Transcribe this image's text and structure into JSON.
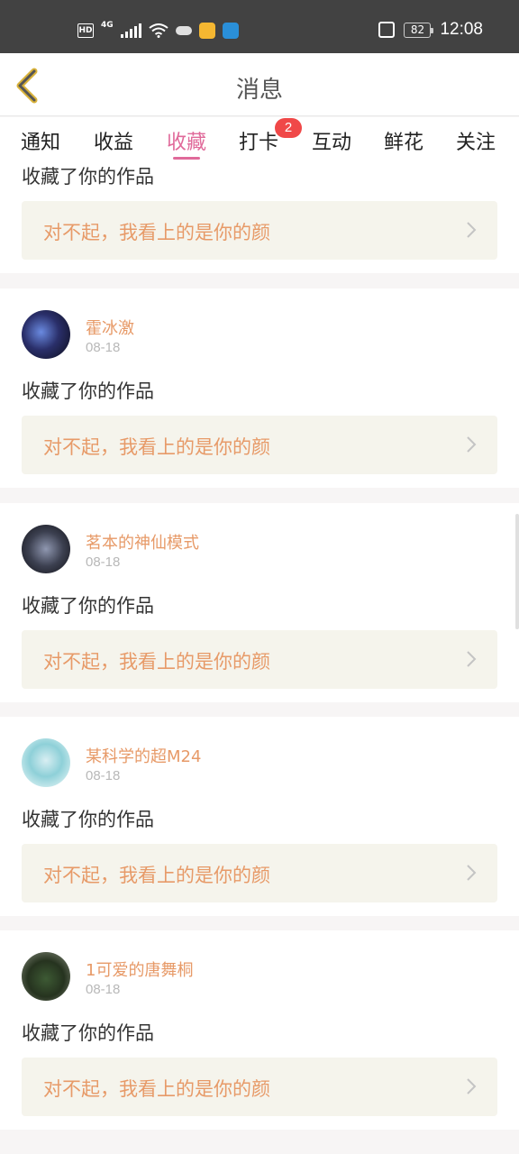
{
  "status_bar": {
    "hd": "HD",
    "network": "4G",
    "battery": "82",
    "time": "12:08"
  },
  "header": {
    "title": "消息"
  },
  "tabs": [
    {
      "label": "通知"
    },
    {
      "label": "收益"
    },
    {
      "label": "收藏",
      "active": true
    },
    {
      "label": "打卡",
      "badge": "2"
    },
    {
      "label": "互动"
    },
    {
      "label": "鲜花"
    },
    {
      "label": "关注"
    }
  ],
  "partial_item": {
    "action": "收藏了你的作品",
    "quote": "对不起，我看上的是你的颜"
  },
  "items": [
    {
      "name": "霍冰激",
      "date": "08-18",
      "action": "收藏了你的作品",
      "quote": "对不起，我看上的是你的颜"
    },
    {
      "name": "茗本的神仙模式",
      "date": "08-18",
      "action": "收藏了你的作品",
      "quote": "对不起，我看上的是你的颜"
    },
    {
      "name": "某科学的超M24",
      "date": "08-18",
      "action": "收藏了你的作品",
      "quote": "对不起，我看上的是你的颜"
    },
    {
      "name": "1可爱的唐舞桐",
      "date": "08-18",
      "action": "收藏了你的作品",
      "quote": "对不起，我看上的是你的颜"
    }
  ],
  "colors": {
    "accent": "#e06a9a",
    "name": "#e79a68",
    "quote_bg": "#f5f4ec",
    "badge": "#f04848"
  }
}
